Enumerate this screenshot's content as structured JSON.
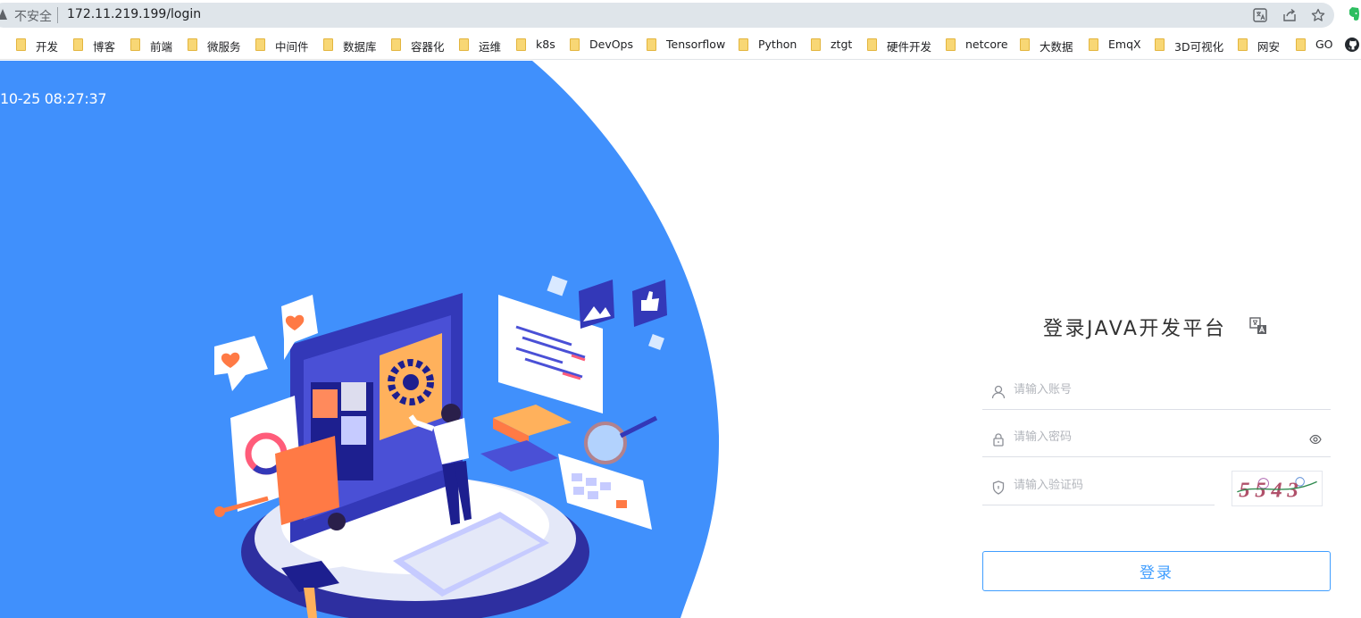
{
  "browser": {
    "security_label": "不安全",
    "url": "172.11.219.199/login"
  },
  "bookmarks": [
    {
      "label": "开发"
    },
    {
      "label": "博客"
    },
    {
      "label": "前端"
    },
    {
      "label": "微服务"
    },
    {
      "label": "中间件"
    },
    {
      "label": "数据库"
    },
    {
      "label": "容器化"
    },
    {
      "label": "运维"
    },
    {
      "label": "k8s"
    },
    {
      "label": "DevOps"
    },
    {
      "label": "Tensorflow"
    },
    {
      "label": "Python"
    },
    {
      "label": "ztgt"
    },
    {
      "label": "硬件开发"
    },
    {
      "label": "netcore"
    },
    {
      "label": "大数据"
    },
    {
      "label": "EmqX"
    },
    {
      "label": "3D可视化"
    },
    {
      "label": "网安"
    },
    {
      "label": "GO"
    }
  ],
  "hero": {
    "clock_text": "10-25 08:27:37"
  },
  "login": {
    "title": "登录JAVA开发平台",
    "username_placeholder": "请输入账号",
    "password_placeholder": "请输入密码",
    "captcha_placeholder": "请输入验证码",
    "captcha_code": "5543",
    "submit_label": "登录"
  },
  "colors": {
    "brand_blue": "#4090fc",
    "accent": "#409eff"
  }
}
